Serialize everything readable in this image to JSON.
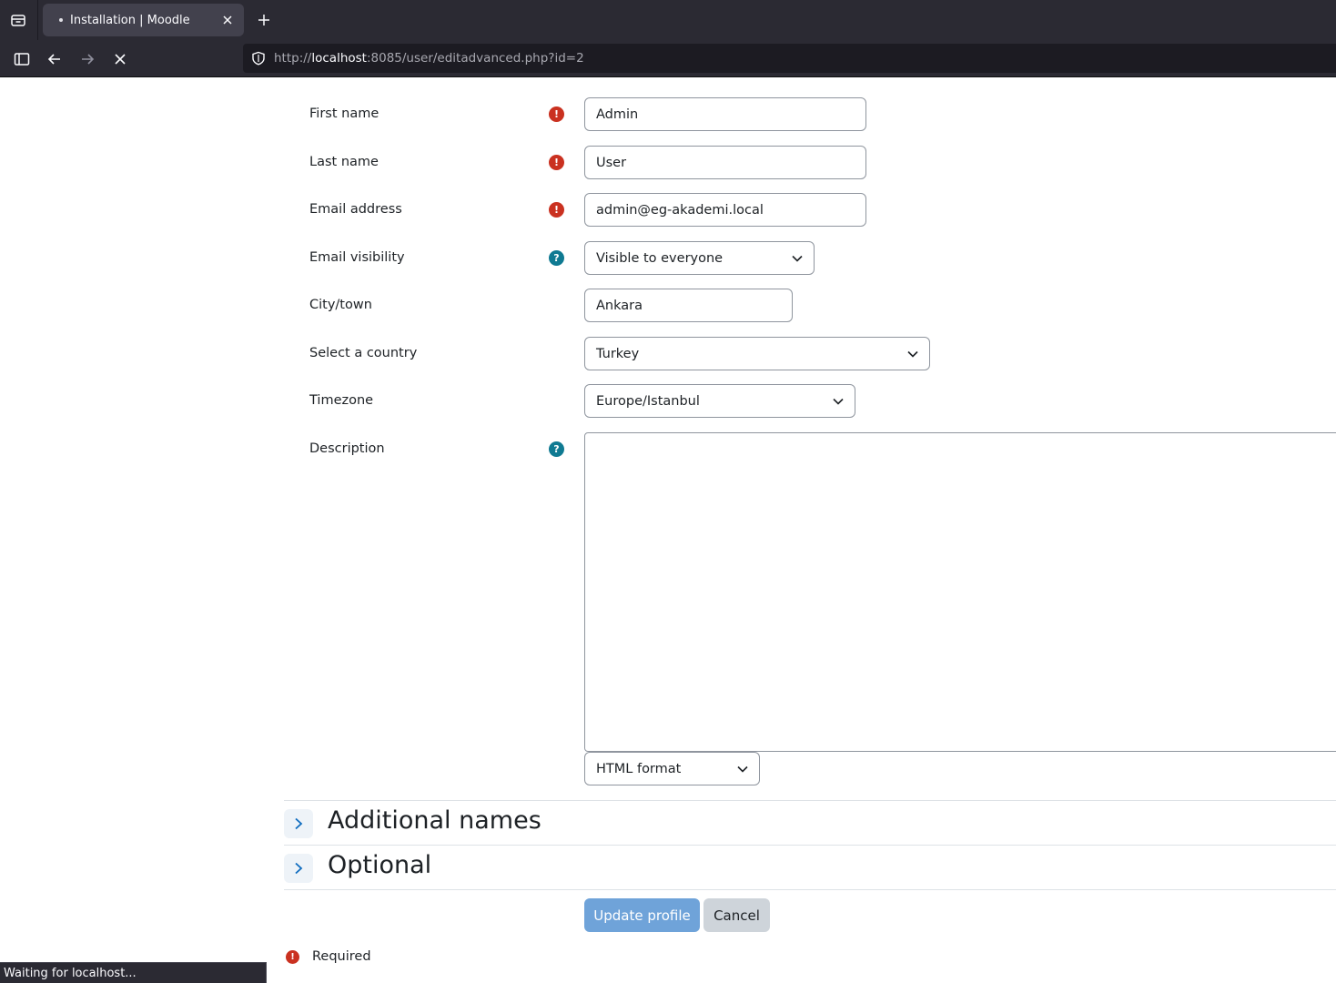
{
  "browser": {
    "tab_title": "Installation | Moodle",
    "url_scheme": "http://",
    "url_host": "localhost",
    "url_rest": ":8085/user/editadvanced.php?id=2",
    "status_text": "Waiting for localhost..."
  },
  "form": {
    "first_name": {
      "label": "First name",
      "value": "Admin"
    },
    "last_name": {
      "label": "Last name",
      "value": "User"
    },
    "email": {
      "label": "Email address",
      "value": "admin@eg-akademi.local"
    },
    "email_visibility": {
      "label": "Email visibility",
      "value": "Visible to everyone"
    },
    "city": {
      "label": "City/town",
      "value": "Ankara"
    },
    "country": {
      "label": "Select a country",
      "value": "Turkey"
    },
    "timezone": {
      "label": "Timezone",
      "value": "Europe/Istanbul"
    },
    "description": {
      "label": "Description",
      "format": "HTML format"
    }
  },
  "sections": {
    "additional_names": "Additional names",
    "optional": "Optional"
  },
  "buttons": {
    "update": "Update profile",
    "cancel": "Cancel"
  },
  "required_note": "Required",
  "icons": {
    "required": "exclamation-circle-icon",
    "help": "question-circle-icon"
  },
  "colors": {
    "required": "#ca3120",
    "help": "#0f7a92",
    "primary_button": "#6fa3d9"
  }
}
